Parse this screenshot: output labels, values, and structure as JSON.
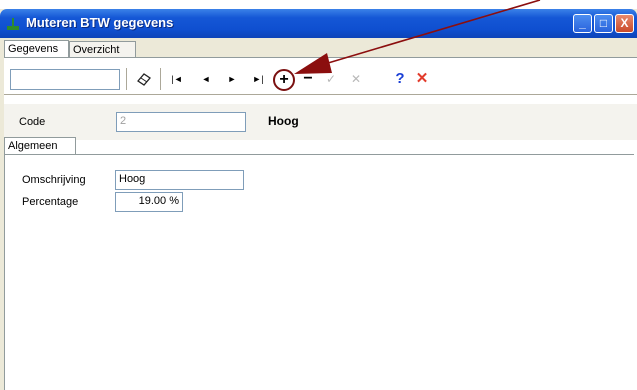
{
  "window": {
    "title": "Muteren BTW gegevens",
    "controls": {
      "minimize": "_",
      "maximize": "□",
      "close": "X"
    }
  },
  "main_tabs": [
    {
      "label": "Gegevens"
    },
    {
      "label": "Overzicht"
    }
  ],
  "toolbar": {
    "navigator_value": "",
    "icons": [
      "eraser-icon",
      "first-record-icon",
      "prev-record-icon",
      "next-record-icon",
      "last-record-icon",
      "add-record-icon",
      "delete-record-icon",
      "post-icon",
      "cancel-icon",
      "help-icon",
      "close-icon"
    ],
    "first_glyph": "|◄",
    "prev_glyph": "◄",
    "next_glyph": "►",
    "last_glyph": "►|",
    "add_glyph": "+",
    "delete_glyph": "−",
    "post_glyph": "✓",
    "cancel_glyph": "✕",
    "help_glyph": "?",
    "close_glyph": "✕"
  },
  "code_row": {
    "label": "Code",
    "value": "2",
    "description": "Hoog"
  },
  "sub_tabs": [
    {
      "label": "Algemeen"
    }
  ],
  "form": {
    "omschrijving_label": "Omschrijving",
    "omschrijving_value": "Hoog",
    "percentage_label": "Percentage",
    "percentage_value": "19.00 %"
  },
  "colors": {
    "titlebar": "#1557d6",
    "annotation_arrow": "#8b0e0e",
    "close_red": "#e23b2b",
    "help_blue": "#1a3fd6"
  }
}
